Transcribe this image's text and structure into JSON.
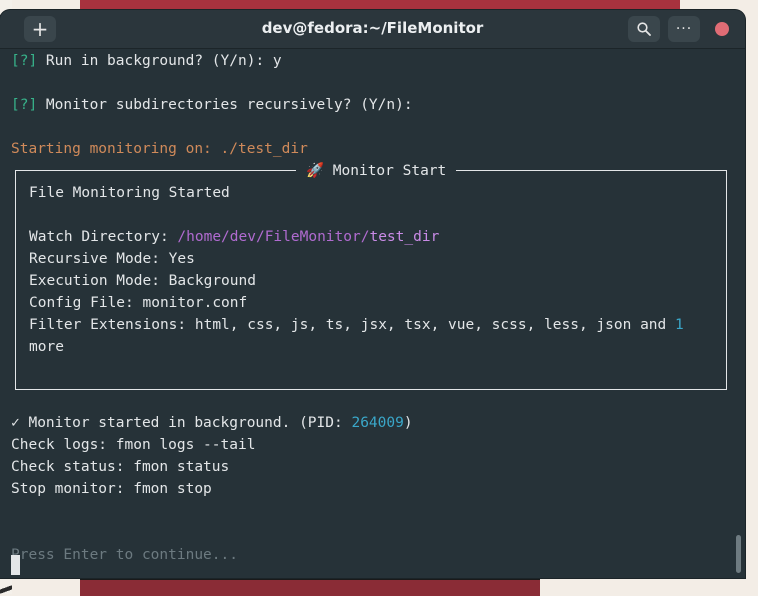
{
  "window": {
    "title": "dev@fedora:~/FileMonitor"
  },
  "titlebar": {
    "new_tab_icon": "+",
    "search_icon": "search",
    "menu_icon": "···"
  },
  "terminal": {
    "prompt1": {
      "bracket": "[?]",
      "text": " Run in background? (Y/n): y"
    },
    "prompt2": {
      "bracket": "[?]",
      "text": " Monitor subdirectories recursively? (Y/n):"
    },
    "starting": "Starting monitoring on: ./test_dir",
    "panel": {
      "title": "🚀 Monitor Start",
      "heading": "File Monitoring Started",
      "watch_label": "Watch Directory: ",
      "watch_path": "/home/dev/FileMonitor/",
      "watch_dir": "test_dir",
      "recursive": "Recursive Mode: Yes",
      "execution": "Execution Mode: Background",
      "config": "Config File: monitor.conf",
      "filter_label": "Filter Extensions: html, css, js, ts, jsx, tsx, vue, scss, less, json and ",
      "filter_count": "1",
      "filter_more": "more"
    },
    "started": {
      "prefix": "✓ Monitor started in background. (PID: ",
      "pid": "264009",
      "suffix": ")"
    },
    "check_logs": "Check logs: fmon logs --tail",
    "check_status": "Check status: fmon status",
    "stop_monitor": "Stop monitor: fmon stop",
    "continue_prompt": "Press Enter to continue..."
  },
  "colors": {
    "accent_green": "#37b38a",
    "path_purple": "#b06bd0",
    "number_cyan": "#3aa7c9",
    "orange": "#d08a5a",
    "close": "#e06c75"
  }
}
